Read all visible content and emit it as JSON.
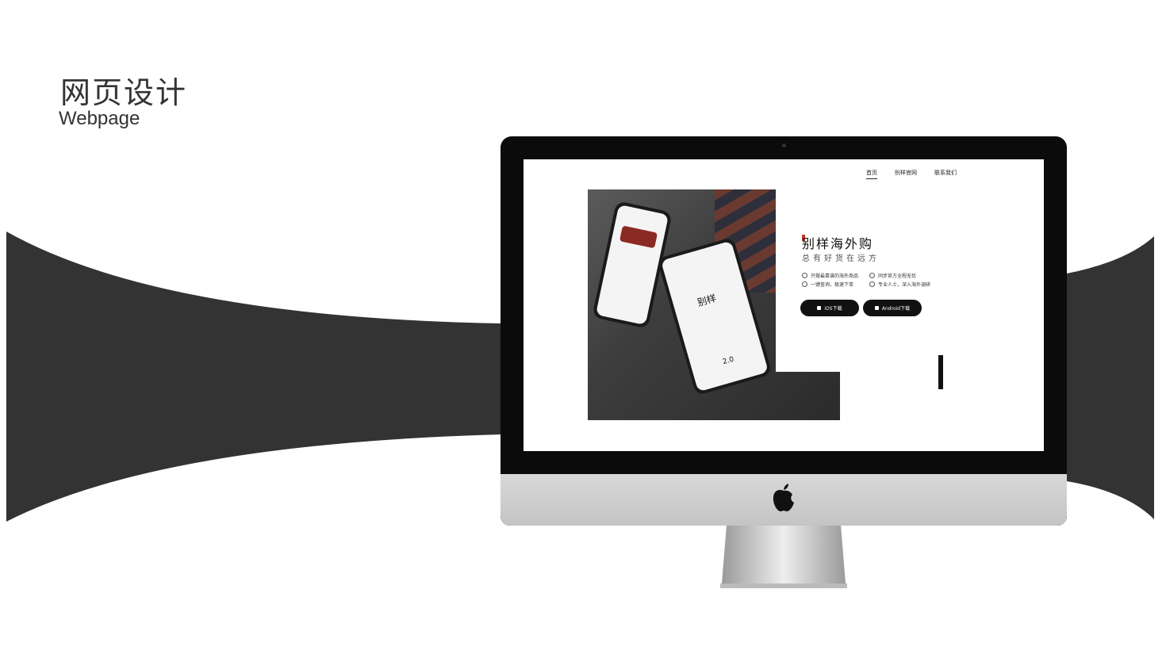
{
  "slide": {
    "title": "网页设计",
    "subtitle": "Webpage"
  },
  "website": {
    "nav": [
      "首页",
      "别样官网",
      "联系我们"
    ],
    "brand": "别样海外购",
    "slogan": "总有好货在远方",
    "features": [
      "只做最靠谱的海外商品",
      "同步官方全程无忧",
      "一键查询，极速下单",
      "专业人士，深入海外调研"
    ],
    "buttons": {
      "ios": "iOS下载",
      "android": "Android下载"
    },
    "phone_logo": "别样",
    "phone_version": "2.0"
  },
  "colors": {
    "band": "#333333",
    "accent": "#c0392b"
  }
}
